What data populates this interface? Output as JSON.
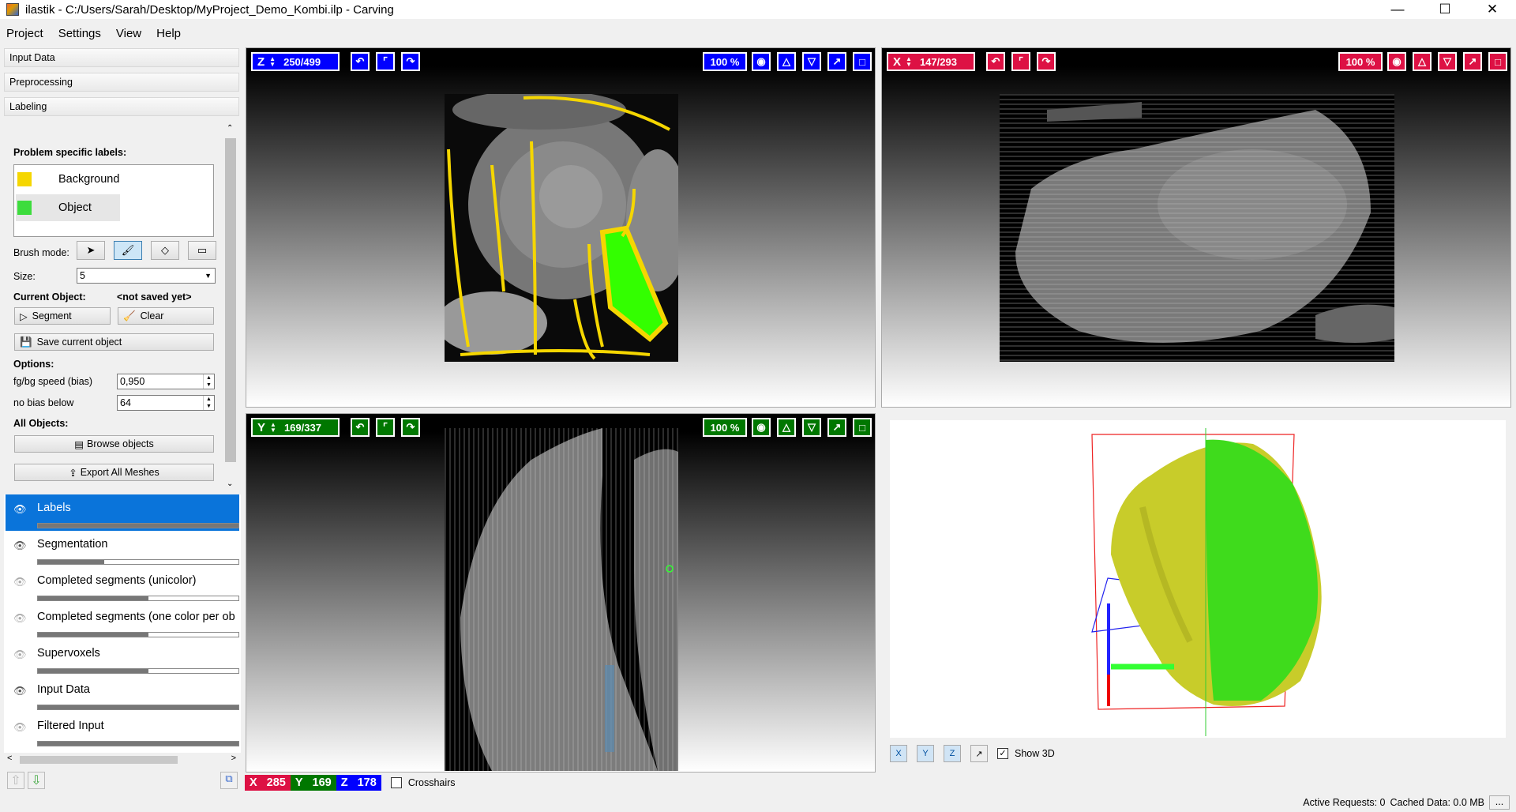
{
  "window": {
    "title": "ilastik - C:/Users/Sarah/Desktop/MyProject_Demo_Kombi.ilp - Carving",
    "minimize": "—",
    "maximize": "☐",
    "close": "✕"
  },
  "menu": [
    "Project",
    "Settings",
    "View",
    "Help"
  ],
  "drawers": [
    "Input Data",
    "Preprocessing",
    "Labeling"
  ],
  "labeling": {
    "problem_labels_heading": "Problem specific labels:",
    "labels": [
      {
        "name": "Background",
        "color": "#f5d600"
      },
      {
        "name": "Object",
        "color": "#3ddc3d"
      }
    ],
    "brush_mode_label": "Brush mode:",
    "size_label": "Size:",
    "size_value": "5",
    "current_object_label": "Current Object:",
    "current_object_value": "<not saved yet>",
    "segment_button": "Segment",
    "clear_button": "Clear",
    "save_button": "Save current object",
    "options_heading": "Options:",
    "bias_label": "fg/bg speed (bias)",
    "bias_value": "0,950",
    "nobias_label": "no bias below",
    "nobias_value": "64",
    "all_objects_heading": "All Objects:",
    "browse_button": "Browse objects",
    "export_button": "Export All Meshes"
  },
  "layers": [
    {
      "name": "Labels",
      "selected": true,
      "visible": true,
      "opacity": 1.0
    },
    {
      "name": "Segmentation",
      "selected": false,
      "visible": true,
      "opacity": 0.33
    },
    {
      "name": "Completed segments (unicolor)",
      "selected": false,
      "visible": false,
      "opacity": 0.55
    },
    {
      "name": "Completed segments (one color per ob",
      "selected": false,
      "visible": false,
      "opacity": 0.55
    },
    {
      "name": "Supervoxels",
      "selected": false,
      "visible": false,
      "opacity": 0.55
    },
    {
      "name": "Input Data",
      "selected": false,
      "visible": true,
      "opacity": 1.0
    },
    {
      "name": "Filtered Input",
      "selected": false,
      "visible": false,
      "opacity": 1.0
    }
  ],
  "views": {
    "z": {
      "axis": "Z",
      "slice": "250/499",
      "zoom": "100 %",
      "color": "#0000ff"
    },
    "x": {
      "axis": "X",
      "slice": "147/293",
      "zoom": "100 %",
      "color": "#dd1144"
    },
    "y": {
      "axis": "Y",
      "slice": "169/337",
      "zoom": "100 %",
      "color": "#007700"
    }
  },
  "toolbar3d": {
    "x": "X",
    "y": "Y",
    "z": "Z",
    "show3d_label": "Show 3D",
    "show3d_checked": true
  },
  "coords": {
    "x_label": "X",
    "x": "285",
    "y_label": "Y",
    "y": "169",
    "z_label": "Z",
    "z": "178",
    "crosshairs_label": "Crosshairs"
  },
  "status": {
    "active_requests": "Active Requests: 0",
    "cached": "Cached Data: 0.0 MB",
    "more": "..."
  }
}
